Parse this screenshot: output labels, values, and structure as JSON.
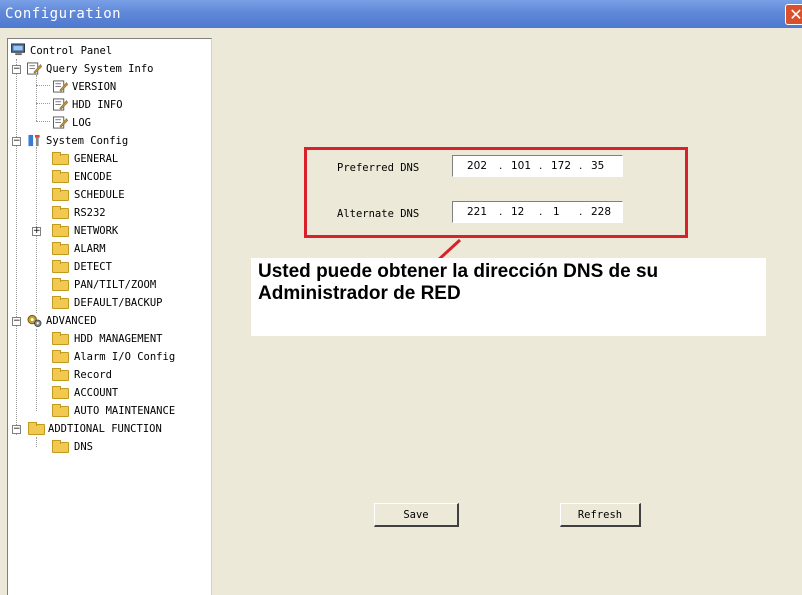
{
  "window": {
    "title": "Configuration",
    "close_label": "✕"
  },
  "tree": {
    "root": "Control Panel",
    "query": "Query System Info",
    "version": "VERSION",
    "hdd_info": "HDD INFO",
    "log": "LOG",
    "system_config": "System Config",
    "general": "GENERAL",
    "encode": "ENCODE",
    "schedule": "SCHEDULE",
    "rs232": "RS232",
    "network": "NETWORK",
    "alarm": "ALARM",
    "detect": "DETECT",
    "ptz": "PAN/TILT/ZOOM",
    "default_backup": "DEFAULT/BACKUP",
    "advanced": "ADVANCED",
    "hdd_mgmt": "HDD MANAGEMENT",
    "alarm_io": "Alarm I/O Config",
    "record": "Record",
    "account": "ACCOUNT",
    "auto_maint": "AUTO MAINTENANCE",
    "additional": "ADDTIONAL FUNCTION",
    "dns": "DNS"
  },
  "dns": {
    "preferred_label": "Preferred DNS",
    "preferred": [
      "202",
      "101",
      "172",
      "35"
    ],
    "alternate_label": "Alternate DNS",
    "alternate": [
      "221",
      "12",
      "1",
      "228"
    ]
  },
  "annotation": {
    "text": "Usted puede obtener la dirección DNS de su Administrador de RED",
    "highlight_color": "#d9212b"
  },
  "buttons": {
    "save": "Save",
    "refresh": "Refresh"
  }
}
